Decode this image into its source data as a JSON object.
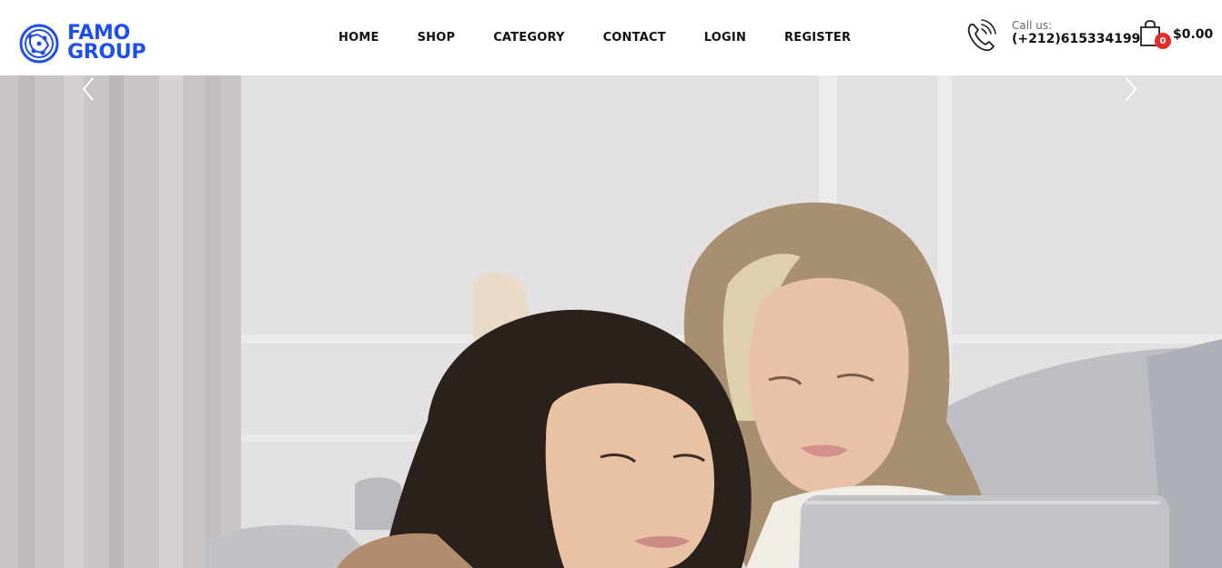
{
  "brand": {
    "line1": "FAMO",
    "line2": "GROUP",
    "color": "#1f4fe6"
  },
  "nav": {
    "items": [
      {
        "label": "HOME"
      },
      {
        "label": "SHOP"
      },
      {
        "label": "CATEGORY"
      },
      {
        "label": "CONTACT"
      },
      {
        "label": "LOGIN"
      },
      {
        "label": "REGISTER"
      }
    ]
  },
  "contact": {
    "label": "Call us:",
    "phone": "(+212)615334199",
    "icon": "phone-icon"
  },
  "cart": {
    "count": "0",
    "total": "$0.00",
    "icon": "shopping-bag-icon",
    "badge_color": "#e32b2b"
  },
  "hero": {
    "image": "two-women-looking-at-laptop",
    "prev_icon": "chevron-left-icon",
    "next_icon": "chevron-right-icon"
  }
}
